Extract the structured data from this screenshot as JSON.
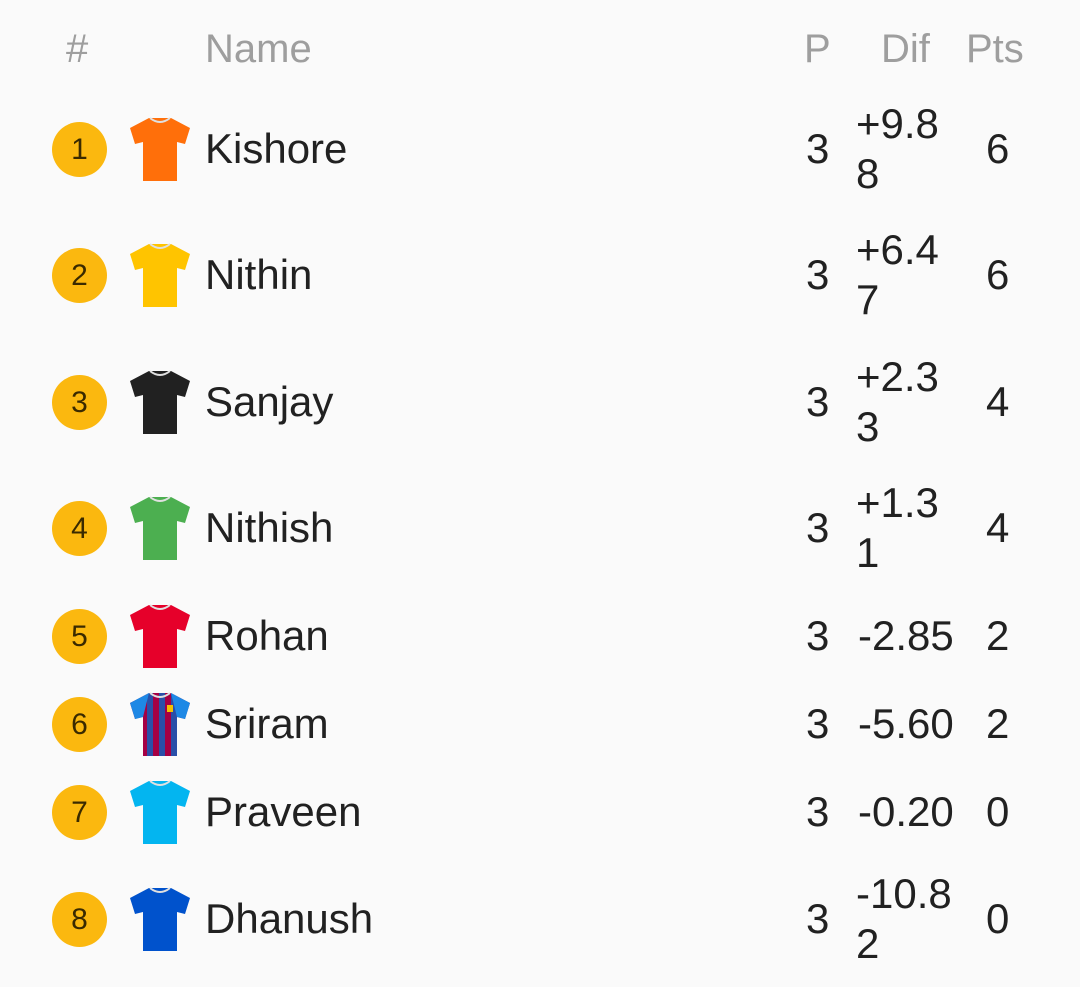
{
  "header": {
    "rank": "#",
    "name": "Name",
    "played": "P",
    "dif": "Dif",
    "pts": "Pts"
  },
  "standings": [
    {
      "rank": "1",
      "name": "Kishore",
      "played": "3",
      "dif": "+9.88",
      "pts": "6",
      "jersey_color": "#ff6f0a",
      "jersey_icon": "orange-jersey-icon"
    },
    {
      "rank": "2",
      "name": "Nithin",
      "played": "3",
      "dif": "+6.47",
      "pts": "6",
      "jersey_color": "#ffc400",
      "jersey_icon": "yellow-jersey-icon"
    },
    {
      "rank": "3",
      "name": "Sanjay",
      "played": "3",
      "dif": "+2.33",
      "pts": "4",
      "jersey_color": "#212121",
      "jersey_icon": "black-jersey-icon"
    },
    {
      "rank": "4",
      "name": "Nithish",
      "played": "3",
      "dif": "+1.31",
      "pts": "4",
      "jersey_color": "#4caf50",
      "jersey_icon": "green-jersey-icon"
    },
    {
      "rank": "5",
      "name": "Rohan",
      "played": "3",
      "dif": "-2.85",
      "pts": "2",
      "jersey_color": "#e6002a",
      "jersey_icon": "red-jersey-icon"
    },
    {
      "rank": "6",
      "name": "Sriram",
      "played": "3",
      "dif": "-5.60",
      "pts": "2",
      "jersey_color": "#a50044",
      "jersey_icon": "barcelona-jersey-icon"
    },
    {
      "rank": "7",
      "name": "Praveen",
      "played": "3",
      "dif": "-0.20",
      "pts": "0",
      "jersey_color": "#03b5f0",
      "jersey_icon": "sky-blue-jersey-icon"
    },
    {
      "rank": "8",
      "name": "Dhanush",
      "played": "3",
      "dif": "-10.82",
      "pts": "0",
      "jersey_color": "#0052cc",
      "jersey_icon": "blue-jersey-icon"
    }
  ]
}
